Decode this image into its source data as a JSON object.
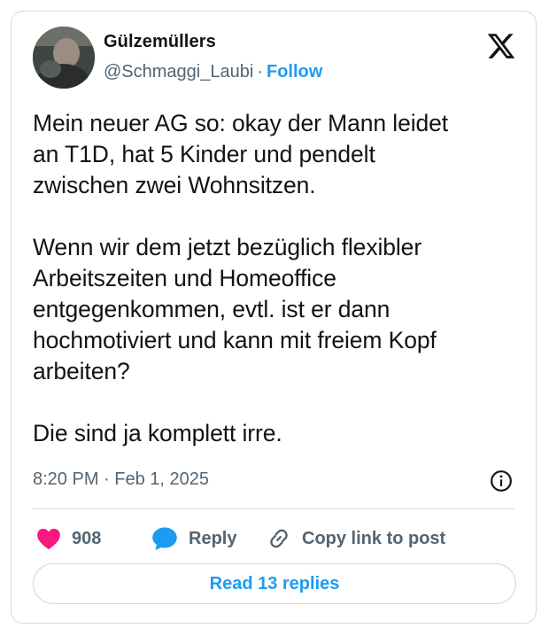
{
  "author": {
    "name": "Gülzemüllers",
    "handle": "@Schmaggi_Laubi",
    "separator": "·",
    "follow_label": "Follow"
  },
  "post": {
    "text": "Mein neuer AG so: okay der Mann leidet\nan T1D, hat 5 Kinder und pendelt\nzwischen zwei Wohnsitzen.\n\nWenn wir dem jetzt bezüglich flexibler\nArbeitszeiten und Homeoffice\nentgegenkommen, evtl. ist er dann\nhochmotiviert und kann mit freiem Kopf\narbeiten?\n\nDie sind ja komplett irre.",
    "time": "8:20 PM",
    "separator": "·",
    "date": "Feb 1, 2025"
  },
  "actions": {
    "like_count": "908",
    "reply_label": "Reply",
    "copy_label": "Copy link to post"
  },
  "read_replies_label": "Read 13 replies",
  "icons": {
    "logo": "x-logo-icon",
    "info": "info-icon",
    "like": "heart-icon",
    "reply": "speech-bubble-icon",
    "copy": "link-icon"
  },
  "colors": {
    "accent": "#1d9bf0",
    "like": "#f91880",
    "secondary_text": "#536471",
    "border": "#cfd9de"
  }
}
